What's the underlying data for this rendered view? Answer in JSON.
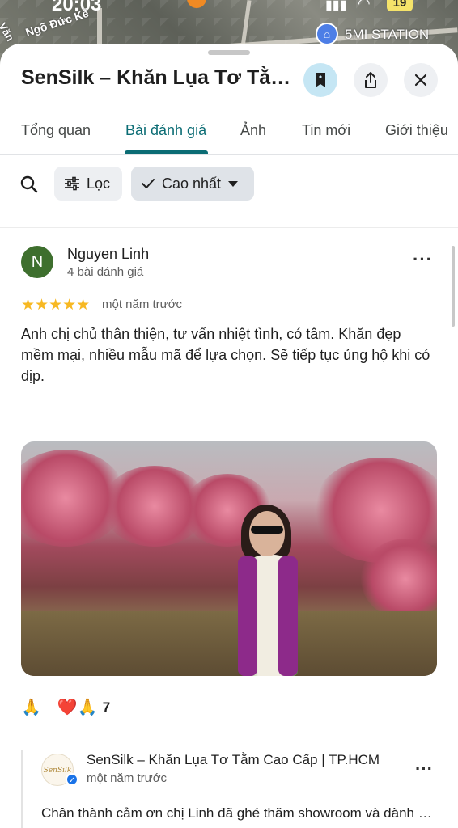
{
  "status_bar": {
    "time": "20:03",
    "battery": "19"
  },
  "map": {
    "road_label": "Ngõ Đức Kế",
    "road_label_2": "Văn",
    "station_label": "5MI STATION"
  },
  "header": {
    "title": "SenSilk – Khăn Lụa Tơ Tằm Cao Cấp | TP.HCM"
  },
  "tabs": [
    {
      "label": "Tổng quan"
    },
    {
      "label": "Bài đánh giá",
      "active": true
    },
    {
      "label": "Ảnh"
    },
    {
      "label": "Tin mới"
    },
    {
      "label": "Giới thiệu"
    }
  ],
  "filters": {
    "filter_label": "Lọc",
    "sort_label": "Cao nhất"
  },
  "review": {
    "avatar_letter": "N",
    "name": "Nguyen Linh",
    "meta": "4 bài đánh giá",
    "rating": 5,
    "stars": "★★★★★",
    "date": "một năm trước",
    "text": "Anh chị chủ thân thiện, tư vấn nhiệt tình, có tâm. Khăn đẹp mềm mại, nhiều mẫu mã để lựa chọn. Sẽ tiếp tục ủng hộ khi có dịp.",
    "reactions": {
      "emoji_1": "🙏",
      "emoji_2": "❤️🙏",
      "count": "7"
    }
  },
  "owner_reply": {
    "avatar_text": "SenSilk",
    "name": "SenSilk – Khăn Lụa Tơ Tằm Cao Cấp | TP.HCM",
    "date": "một năm trước",
    "text": "Chân thành cảm ơn chị Linh đã ghé thăm showroom và dành lời khen"
  },
  "colors": {
    "accent": "#0b6c74",
    "star": "#f7b822",
    "avatar_bg": "#3e6f2e",
    "save_button_bg": "#c5e6f4"
  }
}
